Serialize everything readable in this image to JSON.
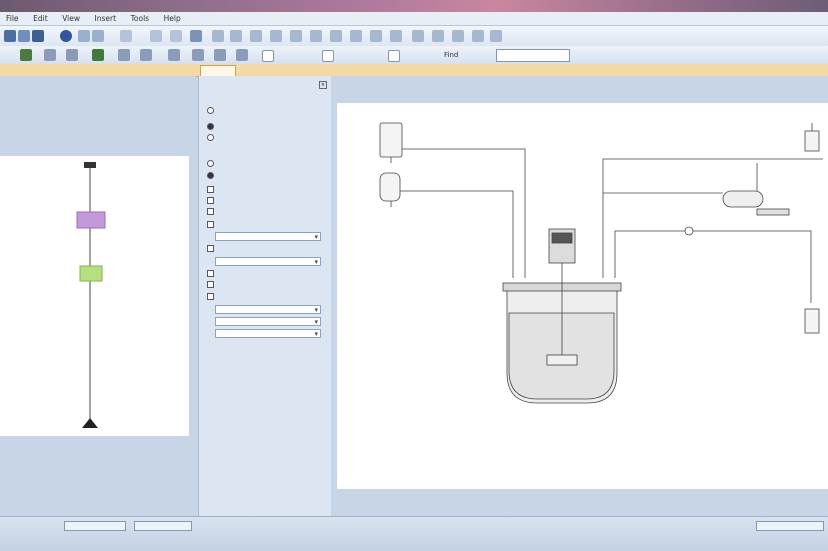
{
  "window": {
    "title": ""
  },
  "menu": {
    "items": [
      "File",
      "Edit",
      "View",
      "Insert",
      "Tools",
      "Help"
    ]
  },
  "toolbar": {
    "find_label": "Find",
    "search_value": ""
  },
  "tab": {
    "active_label": ""
  },
  "options_panel": {
    "title": "",
    "options": [],
    "combos": []
  },
  "left_diagram": {
    "node1_label": "",
    "node2_label": ""
  },
  "status": {
    "left_combo": "",
    "zoom": "",
    "right_combo": "",
    "text": ""
  }
}
